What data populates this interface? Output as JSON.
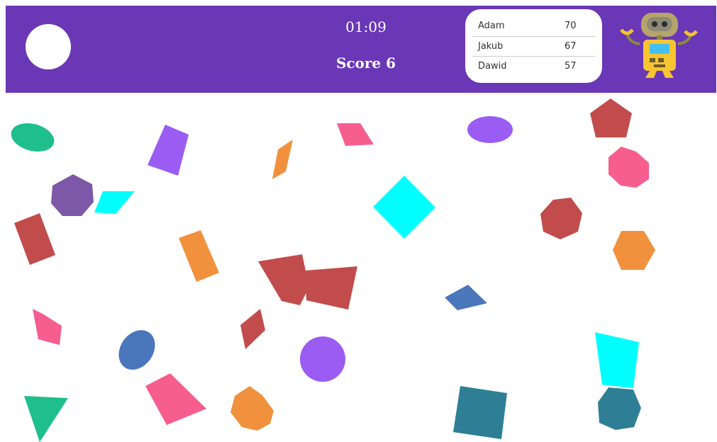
{
  "hud": {
    "timer": "01:09",
    "score": "Score 6"
  },
  "leaderboard": [
    {
      "name": "Adam",
      "score": "70"
    },
    {
      "name": "Jakub",
      "score": "67"
    },
    {
      "name": "Dawid",
      "score": "57"
    }
  ],
  "colors": {
    "header": "#6a37b6",
    "green": "#1ebf8c",
    "purple": "#9a5cf2",
    "orange": "#f2913d",
    "pink": "#f65e8f",
    "red": "#c24c4c",
    "cyan": "#00ffff",
    "violet": "#7e58a8",
    "blue": "#4a76bc",
    "teal": "#2e7f95"
  },
  "icons": {
    "target": "white-circle-icon",
    "mascot": "robot-icon"
  },
  "shapes": [
    {
      "kind": "ellipse",
      "color": "green"
    },
    {
      "kind": "rectangle",
      "color": "purple"
    },
    {
      "kind": "rhombus",
      "color": "orange"
    },
    {
      "kind": "parallelogram",
      "color": "pink"
    },
    {
      "kind": "ellipse",
      "color": "purple"
    },
    {
      "kind": "pentagon",
      "color": "red"
    },
    {
      "kind": "octagon",
      "color": "pink"
    },
    {
      "kind": "heptagon",
      "color": "violet"
    },
    {
      "kind": "parallelogram",
      "color": "cyan"
    },
    {
      "kind": "square",
      "color": "cyan"
    },
    {
      "kind": "heptagon",
      "color": "red"
    },
    {
      "kind": "rectangle",
      "color": "red"
    },
    {
      "kind": "rectangle",
      "color": "orange"
    },
    {
      "kind": "hexagon",
      "color": "orange"
    },
    {
      "kind": "quadrilateral",
      "color": "red"
    },
    {
      "kind": "quadrilateral",
      "color": "red"
    },
    {
      "kind": "rhombus",
      "color": "blue"
    },
    {
      "kind": "kite",
      "color": "pink"
    },
    {
      "kind": "rhombus",
      "color": "red"
    },
    {
      "kind": "ellipse",
      "color": "blue"
    },
    {
      "kind": "circle",
      "color": "purple"
    },
    {
      "kind": "trapezoid",
      "color": "cyan"
    },
    {
      "kind": "triangle",
      "color": "green"
    },
    {
      "kind": "quadrilateral",
      "color": "pink"
    },
    {
      "kind": "octagon",
      "color": "orange"
    },
    {
      "kind": "square",
      "color": "teal"
    },
    {
      "kind": "octagon",
      "color": "teal"
    }
  ]
}
